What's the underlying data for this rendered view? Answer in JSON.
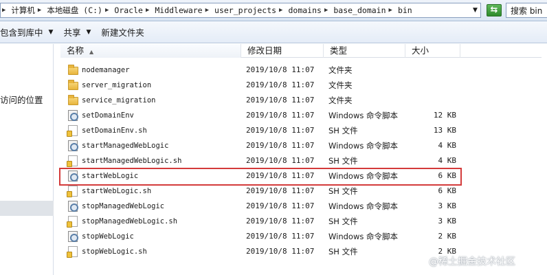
{
  "address": {
    "breadcrumbs": [
      "计算机",
      "本地磁盘 (C:)",
      "Oracle",
      "Middleware",
      "user_projects",
      "domains",
      "base_domain",
      "bin"
    ],
    "search_placeholder": "搜索 bin"
  },
  "toolbar": {
    "include_label": "包含到库中",
    "share_label": "共享",
    "new_folder_label": "新建文件夹"
  },
  "nav": {
    "recent_label": "访问的位置"
  },
  "columns": {
    "name": "名称",
    "date": "修改日期",
    "type": "类型",
    "size": "大小"
  },
  "files": [
    {
      "name": "nodemanager",
      "date": "2019/10/8 11:07",
      "type": "文件夹",
      "size": "",
      "icon": "folder-icon"
    },
    {
      "name": "server_migration",
      "date": "2019/10/8 11:07",
      "type": "文件夹",
      "size": "",
      "icon": "folder-icon"
    },
    {
      "name": "service_migration",
      "date": "2019/10/8 11:07",
      "type": "文件夹",
      "size": "",
      "icon": "folder-icon"
    },
    {
      "name": "setDomainEnv",
      "date": "2019/10/8 11:07",
      "type": "Windows 命令脚本",
      "size": "12 KB",
      "icon": "cmd-script-icon"
    },
    {
      "name": "setDomainEnv.sh",
      "date": "2019/10/8 11:07",
      "type": "SH 文件",
      "size": "13 KB",
      "icon": "sh-file-icon"
    },
    {
      "name": "startManagedWebLogic",
      "date": "2019/10/8 11:07",
      "type": "Windows 命令脚本",
      "size": "4 KB",
      "icon": "cmd-script-icon"
    },
    {
      "name": "startManagedWebLogic.sh",
      "date": "2019/10/8 11:07",
      "type": "SH 文件",
      "size": "4 KB",
      "icon": "sh-file-icon"
    },
    {
      "name": "startWebLogic",
      "date": "2019/10/8 11:07",
      "type": "Windows 命令脚本",
      "size": "6 KB",
      "icon": "cmd-script-icon"
    },
    {
      "name": "startWebLogic.sh",
      "date": "2019/10/8 11:07",
      "type": "SH 文件",
      "size": "6 KB",
      "icon": "sh-file-icon"
    },
    {
      "name": "stopManagedWebLogic",
      "date": "2019/10/8 11:07",
      "type": "Windows 命令脚本",
      "size": "3 KB",
      "icon": "cmd-script-icon"
    },
    {
      "name": "stopManagedWebLogic.sh",
      "date": "2019/10/8 11:07",
      "type": "SH 文件",
      "size": "3 KB",
      "icon": "sh-file-icon"
    },
    {
      "name": "stopWebLogic",
      "date": "2019/10/8 11:07",
      "type": "Windows 命令脚本",
      "size": "2 KB",
      "icon": "cmd-script-icon"
    },
    {
      "name": "stopWebLogic.sh",
      "date": "2019/10/8 11:07",
      "type": "SH 文件",
      "size": "2 KB",
      "icon": "sh-file-icon"
    }
  ],
  "highlighted_file": "startWebLogic",
  "watermark": "@稀土掘金技术社区",
  "colors": {
    "highlight_outline": "#d33a3a",
    "go_button": "#3a9a36"
  }
}
